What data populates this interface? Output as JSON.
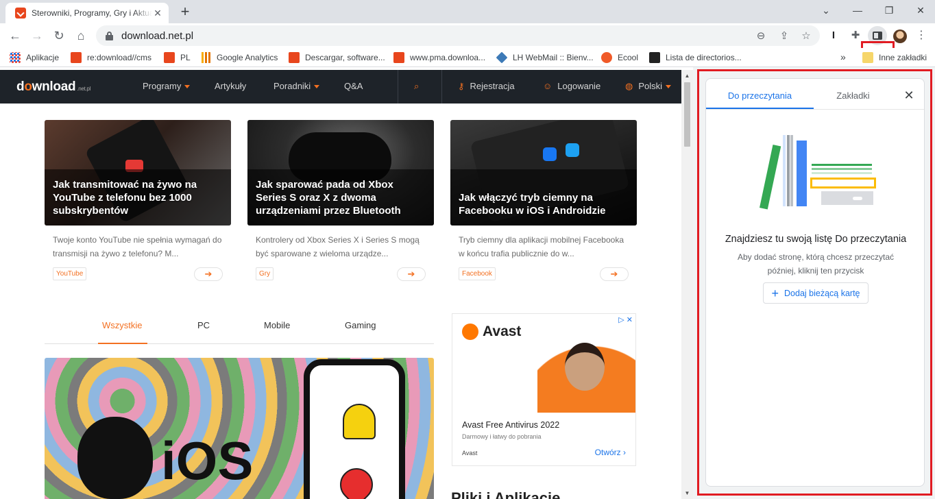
{
  "browser": {
    "tab_title": "Sterowniki, Programy, Gry i Aktualności",
    "url": "download.net.pl",
    "new_tab": "+",
    "bookmarks": [
      {
        "label": "Aplikacje",
        "icon": "apps-icon"
      },
      {
        "label": "re:download//cms",
        "icon": "download-icon"
      },
      {
        "label": "PL",
        "icon": "download-icon"
      },
      {
        "label": "Google Analytics",
        "icon": "analytics-icon"
      },
      {
        "label": "Descargar, software...",
        "icon": "download-icon"
      },
      {
        "label": "www.pma.downloa...",
        "icon": "download-icon"
      },
      {
        "label": "LH WebMail :: Bienv...",
        "icon": "webmail-icon"
      },
      {
        "label": "Ecool",
        "icon": "ecool-icon"
      },
      {
        "label": "Lista de directorios...",
        "icon": "lista-icon"
      }
    ],
    "bookmarks_more": "»",
    "other_bookmarks": "Inne zakładki"
  },
  "site": {
    "logo_main": "dwnload",
    "logo_sub": ".net.pl",
    "nav": {
      "programy": "Programy",
      "artykuly": "Artykuły",
      "poradniki": "Poradniki",
      "qa": "Q&A",
      "rejestracja": "Rejestracja",
      "logowanie": "Logowanie",
      "polski": "Polski"
    },
    "cards": [
      {
        "title": "Jak transmitować na żywo na YouTube z telefonu bez 1000 subskrybentów",
        "desc": "Twoje konto YouTube nie spełnia wymagań do transmisji na żywo z telefonu? M...",
        "tag": "YouTube"
      },
      {
        "title": "Jak sparować pada od Xbox Series S oraz X z dwoma urządzeniami przez Bluetooth",
        "desc": "Kontrolery od Xbox Series X i Series S mogą być sparowane z wieloma urządze...",
        "tag": "Gry"
      },
      {
        "title": "Jak włączyć tryb ciemny na Facebooku w iOS i Androidzie",
        "desc": "Tryb ciemny dla aplikacji mobilnej Facebooka w końcu trafia publicznie do w...",
        "tag": "Facebook"
      }
    ],
    "filter_tabs": [
      "Wszystkie",
      "PC",
      "Mobile",
      "Gaming"
    ],
    "big_image_text": "iOS",
    "ad": {
      "brand_logo": "Avast",
      "title": "Avast Free Antivirus 2022",
      "subtitle": "Darmowy i łatwy do pobrania",
      "brand": "Avast",
      "cta": "Otwórz ›",
      "close": "▷ ✕"
    },
    "section_title": "Pliki i Aplikacje"
  },
  "side_panel": {
    "tab_reading": "Do przeczytania",
    "tab_bookmarks": "Zakładki",
    "close": "✕",
    "heading": "Znajdziesz tu swoją listę Do przeczytania",
    "text": "Aby dodać stronę, którą chcesz przeczytać później, kliknij ten przycisk",
    "add_button": "Dodaj bieżącą kartę"
  },
  "colors": {
    "accent_orange": "#f37021",
    "chrome_blue": "#1a73e8",
    "highlight_red": "#e11b22"
  }
}
